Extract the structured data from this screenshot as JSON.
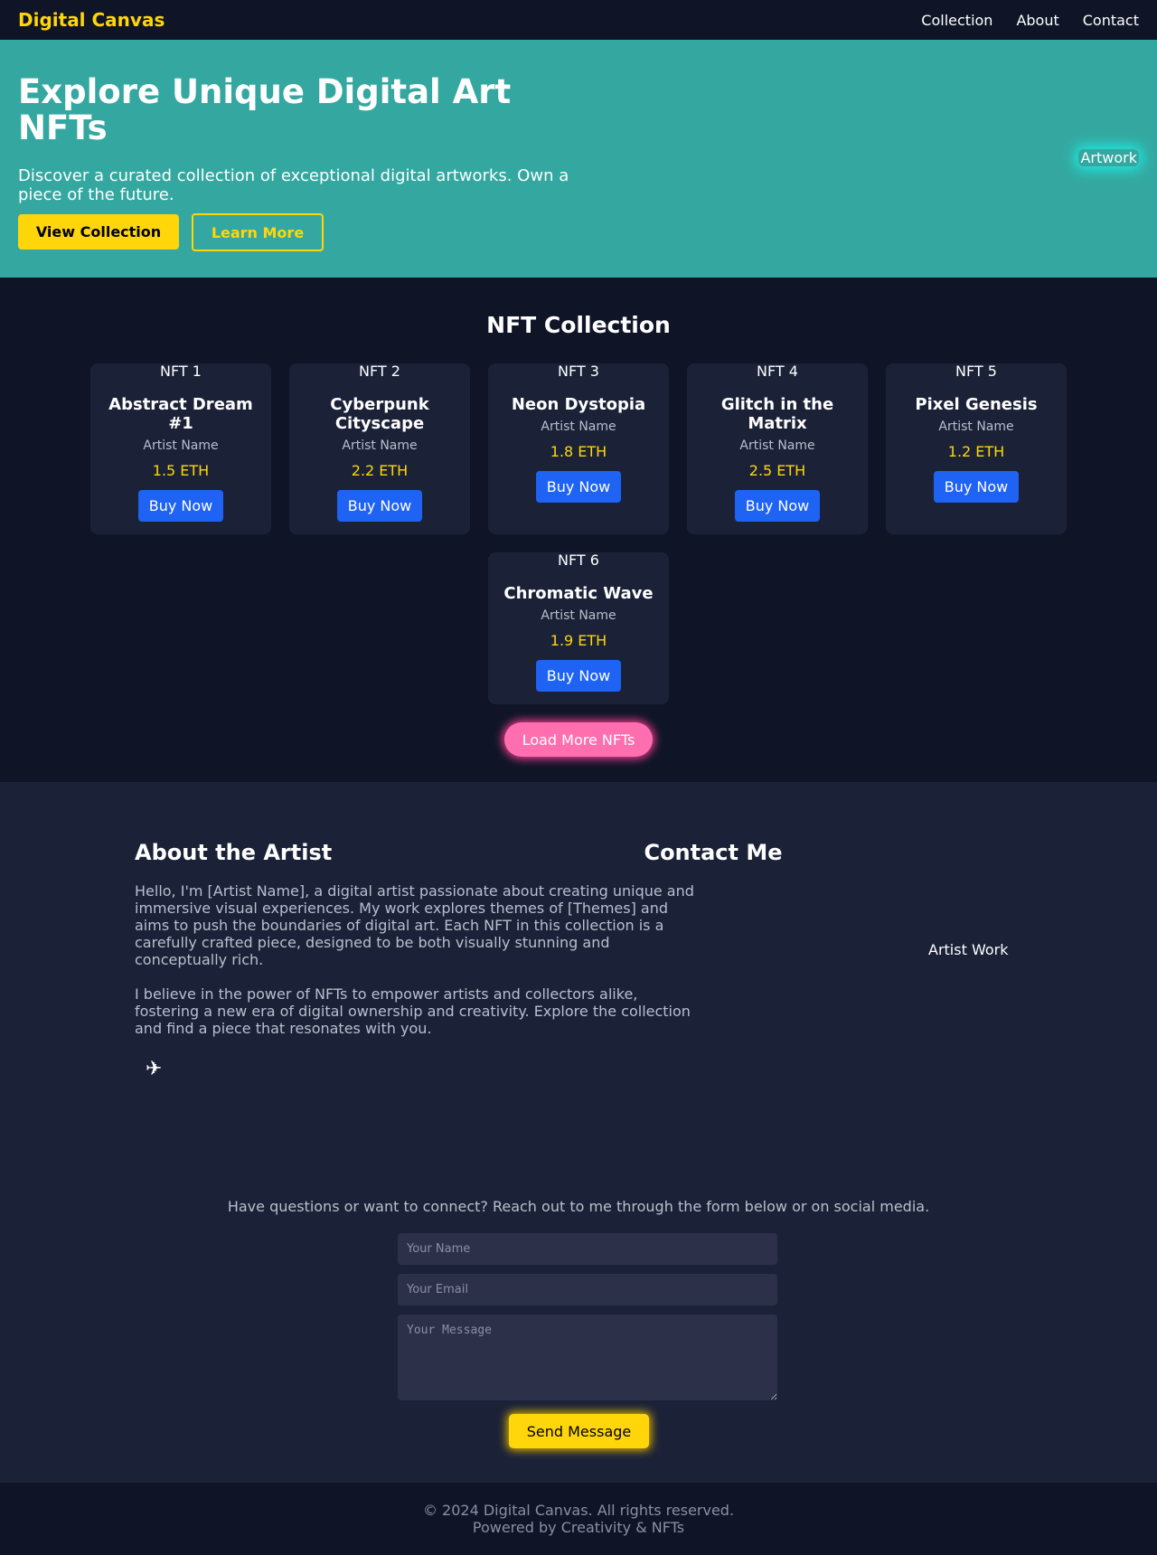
{
  "nav": {
    "brand": "Digital Canvas",
    "links": [
      "Collection",
      "About",
      "Contact"
    ]
  },
  "hero": {
    "title": "Explore Unique Digital Art NFTs",
    "subtitle": "Discover a curated collection of exceptional digital artworks. Own a piece of the future.",
    "primary_button": "View Collection",
    "secondary_button": "Learn More",
    "image_alt": "Artwork"
  },
  "collection": {
    "title": "NFT Collection",
    "items": [
      {
        "image_alt": "NFT 1",
        "name": "Abstract Dream #1",
        "artist": "Artist Name",
        "price": "1.5 ETH",
        "button": "Buy Now"
      },
      {
        "image_alt": "NFT 2",
        "name": "Cyberpunk Cityscape",
        "artist": "Artist Name",
        "price": "2.2 ETH",
        "button": "Buy Now"
      },
      {
        "image_alt": "NFT 3",
        "name": "Neon Dystopia",
        "artist": "Artist Name",
        "price": "1.8 ETH",
        "button": "Buy Now"
      },
      {
        "image_alt": "NFT 4",
        "name": "Glitch in the Matrix",
        "artist": "Artist Name",
        "price": "2.5 ETH",
        "button": "Buy Now"
      },
      {
        "image_alt": "NFT 5",
        "name": "Pixel Genesis",
        "artist": "Artist Name",
        "price": "1.2 ETH",
        "button": "Buy Now"
      },
      {
        "image_alt": "NFT 6",
        "name": "Chromatic Wave",
        "artist": "Artist Name",
        "price": "1.9 ETH",
        "button": "Buy Now"
      }
    ],
    "load_more": "Load More NFTs"
  },
  "about": {
    "title": "About the Artist",
    "paragraph1": "Hello, I'm [Artist Name], a digital artist passionate about creating unique and immersive visual experiences. My work explores themes of [Themes] and aims to push the boundaries of digital art. Each NFT in this collection is a carefully crafted piece, designed to be both visually stunning and conceptually rich.",
    "paragraph2": "I believe in the power of NFTs to empower artists and collectors alike, fostering a new era of digital ownership and creativity. Explore the collection and find a piece that resonates with you.",
    "socials": [
      "",
      "",
      "✈"
    ],
    "image_alt": "Artist Work"
  },
  "contact": {
    "title": "Contact Me",
    "subtitle": "Have questions or want to connect? Reach out to me through the form below or on social media.",
    "name_placeholder": "Your Name",
    "email_placeholder": "Your Email",
    "message_placeholder": "Your Message",
    "send_button": "Send Message"
  },
  "footer": {
    "copyright": "© 2024 Digital Canvas. All rights reserved.",
    "tagline": "Powered by Creativity & NFTs"
  },
  "colors": {
    "accent": "#ffd60a",
    "hero_bg": "#34a8a0",
    "page_bg": "#0f1527",
    "card_bg": "#1b2238",
    "buy_button": "#1e63f3",
    "load_more": "#ff6fb0"
  }
}
